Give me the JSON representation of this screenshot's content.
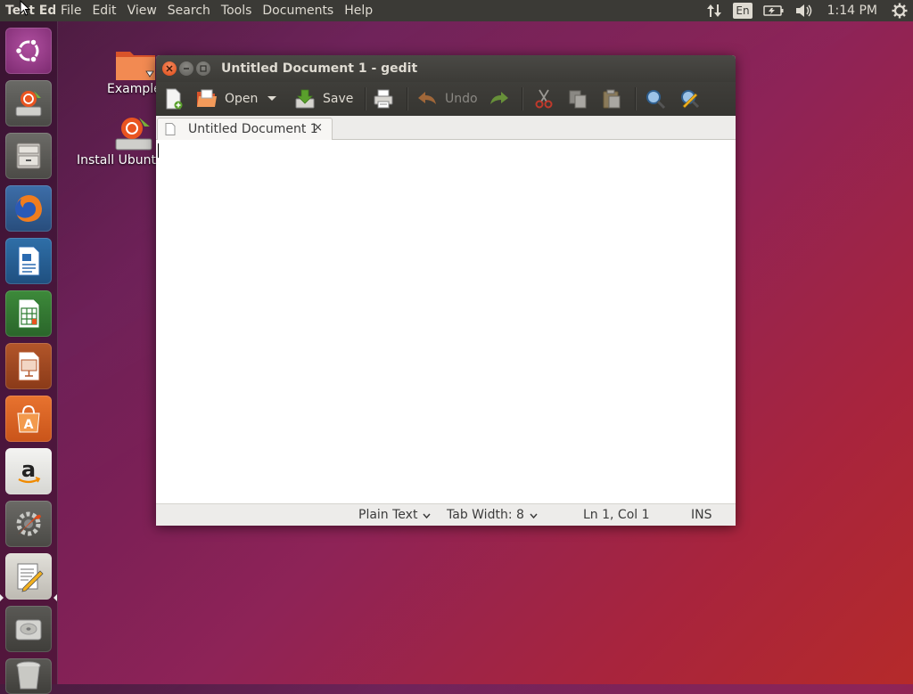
{
  "top_panel": {
    "app_title": "Text Editor",
    "menus": [
      "File",
      "Edit",
      "View",
      "Search",
      "Tools",
      "Documents",
      "Help"
    ],
    "keyboard_layout": "En",
    "clock": "1:14 PM"
  },
  "launcher": {
    "items": [
      {
        "name": "dash-home",
        "icon": "ubuntu-logo-icon"
      },
      {
        "name": "install-ubuntu",
        "icon": "installer-icon"
      },
      {
        "name": "files",
        "icon": "file-cabinet-icon"
      },
      {
        "name": "firefox",
        "icon": "firefox-icon"
      },
      {
        "name": "libreoffice-writer",
        "icon": "writer-icon"
      },
      {
        "name": "libreoffice-calc",
        "icon": "calc-icon"
      },
      {
        "name": "libreoffice-impress",
        "icon": "impress-icon"
      },
      {
        "name": "ubuntu-software",
        "icon": "software-center-icon"
      },
      {
        "name": "amazon",
        "icon": "amazon-icon"
      },
      {
        "name": "system-settings",
        "icon": "settings-wrench-icon"
      },
      {
        "name": "text-editor",
        "icon": "text-editor-icon",
        "active": true
      },
      {
        "name": "disk",
        "icon": "hard-disk-icon"
      },
      {
        "name": "trash",
        "icon": "trash-icon"
      }
    ]
  },
  "desktop": {
    "icons": [
      {
        "label": "Examples",
        "icon": "folder-icon"
      },
      {
        "label": "Install Ubuntu",
        "icon": "installer-icon"
      }
    ]
  },
  "window": {
    "title": "Untitled Document 1 - gedit",
    "toolbar": {
      "new_icon": "new-document-icon",
      "open_label": "Open",
      "save_label": "Save",
      "print_icon": "print-icon",
      "undo_label": "Undo",
      "redo_icon": "redo-icon",
      "cut_icon": "cut-icon",
      "copy_icon": "copy-icon",
      "paste_icon": "paste-icon",
      "find_icon": "find-icon",
      "replace_icon": "find-replace-icon"
    },
    "tab": {
      "label": "Untitled Document 1",
      "close": "×"
    },
    "editor": {
      "content": ""
    },
    "statusbar": {
      "language": "Plain Text",
      "tab_width": "Tab Width: 8",
      "position": "Ln 1, Col 1",
      "mode": "INS"
    }
  },
  "colors": {
    "panel_bg": "#3b3a36",
    "panel_text": "#dfdbd2",
    "close_button": "#df4a16",
    "wallpaper_start": "#3c0f33",
    "wallpaper_end": "#b52a2a"
  }
}
